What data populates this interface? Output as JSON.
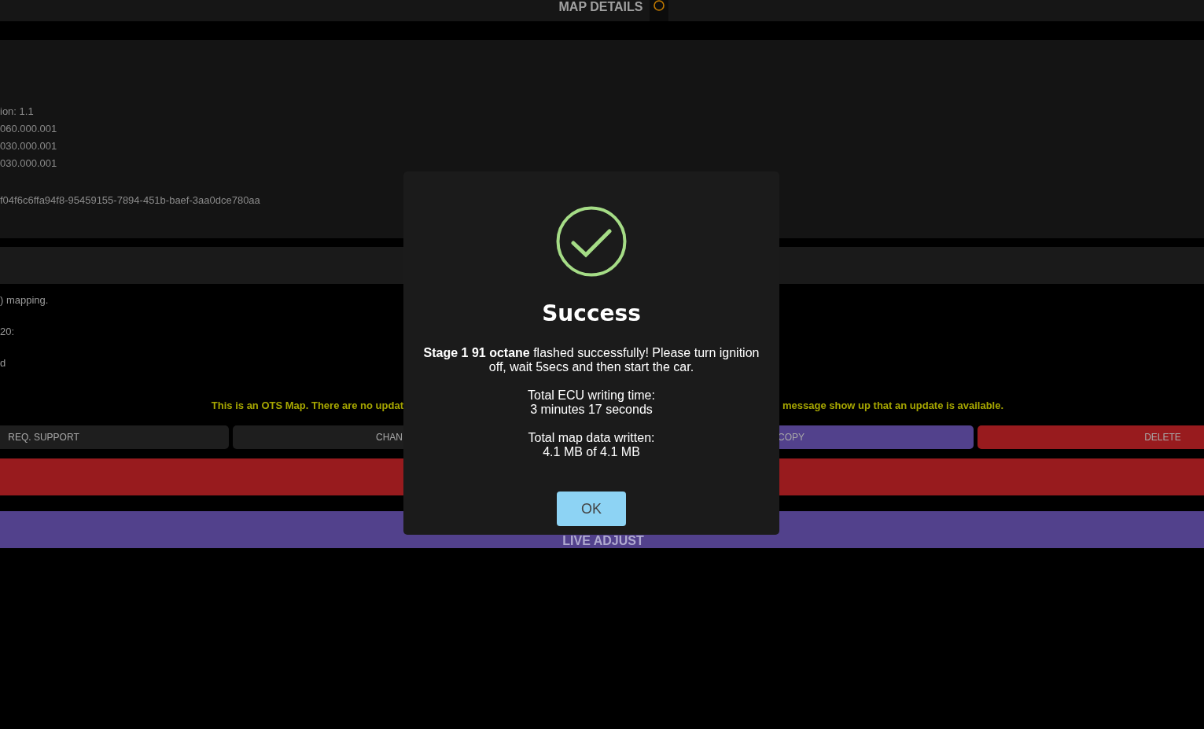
{
  "header": {
    "title": "MAP DETAILS"
  },
  "details": [
    "ion: 1.1",
    "060.000.001",
    "030.000.001",
    "030.000.001"
  ],
  "map_id": "f04f6c6ffa94f8-95459155-7894-451b-baef-3aa0dce780aa",
  "notes": [
    ") mapping.",
    "20:",
    "d"
  ],
  "notice": {
    "left": "This is an OTS Map. There are no updat",
    "right": "message show up that an update is available."
  },
  "buttons": [
    {
      "label": "REQ. SUPPORT",
      "kind": "plain"
    },
    {
      "label": "CHAN",
      "kind": "plain"
    },
    {
      "label": "COPY",
      "kind": "purple"
    },
    {
      "label": "DELETE",
      "kind": "red"
    }
  ],
  "live_adjust": "LIVE ADJUST",
  "dialog": {
    "title": "Success",
    "message": "**Stage 1 91 octane** flashed successfully! Please turn ignition off, wait 5secs and then start the car.",
    "time_label": "Total ECU writing time:",
    "time_value": "3 minutes 17 seconds",
    "data_label": "Total map data written:",
    "data_value": "4.1 MB of 4.1 MB",
    "button": "OK"
  }
}
